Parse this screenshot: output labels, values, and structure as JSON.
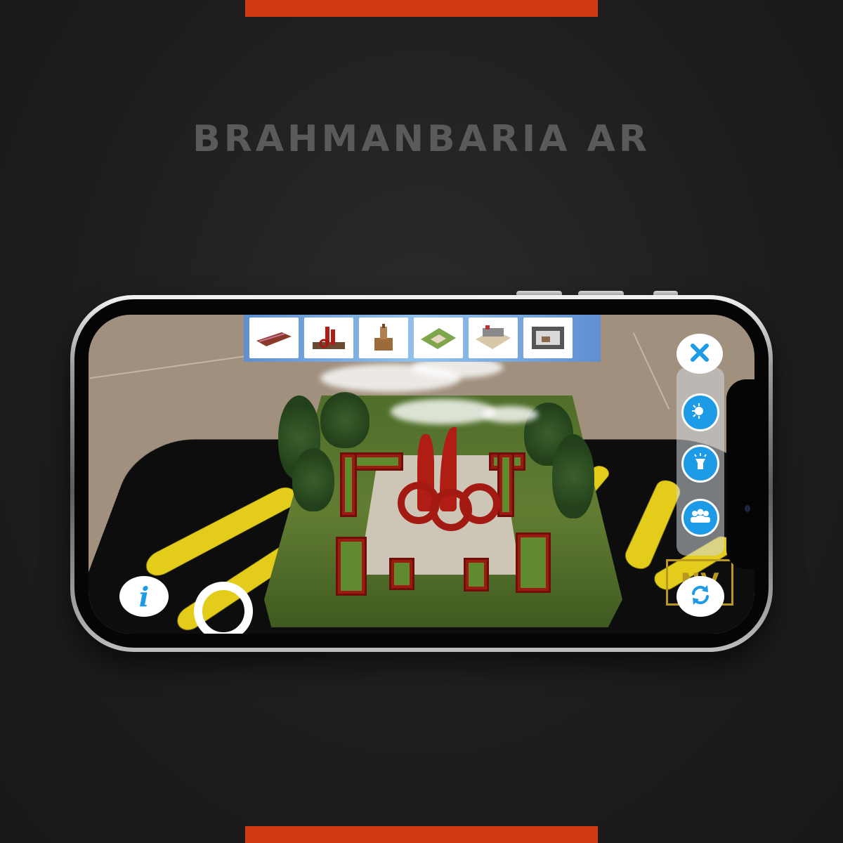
{
  "header": {
    "title": "BRAHMANBARIA AR"
  },
  "colors": {
    "accent": "#cf3a12",
    "title": "#5a5a5a",
    "button_blue": "#1e9be6",
    "toolbar_blue": "#6d9fdb"
  },
  "toolbar": {
    "models": [
      {
        "icon": "bridge-model-thumbnail"
      },
      {
        "icon": "monument-model-thumbnail"
      },
      {
        "icon": "tower-model-thumbnail"
      },
      {
        "icon": "park-model-thumbnail"
      },
      {
        "icon": "building-model-thumbnail"
      },
      {
        "icon": "room-model-thumbnail"
      }
    ]
  },
  "controls": {
    "close": {
      "icon": "close-icon"
    },
    "day_night": {
      "icon": "day-night-icon"
    },
    "flashlight": {
      "icon": "flashlight-icon"
    },
    "people": {
      "icon": "people-icon"
    },
    "info": {
      "icon": "info-icon",
      "label": "i"
    },
    "refresh": {
      "icon": "refresh-icon"
    }
  }
}
